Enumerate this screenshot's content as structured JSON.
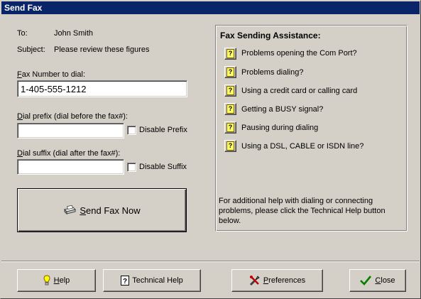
{
  "window": {
    "title": "Send Fax"
  },
  "message": {
    "to_label": "To:",
    "to_value": "John Smith",
    "subject_label": "Subject:",
    "subject_value": "Please review these figures"
  },
  "fax_number": {
    "label_accel": "F",
    "label_rest": "ax Number to dial:",
    "value": "1-405-555-1212"
  },
  "dial_prefix": {
    "label_accel": "D",
    "label_rest": "ial prefix (dial before the fax#):",
    "value": "",
    "checkbox_label": "Disable Prefix",
    "checked": false
  },
  "dial_suffix": {
    "label_accel": "D",
    "label_rest": "ial suffix (dial after the fax#):",
    "value": "",
    "checkbox_label": "Disable Suffix",
    "checked": false
  },
  "send_button": {
    "label_accel": "S",
    "label_rest": "end Fax Now",
    "icon": "fax-machine-icon"
  },
  "assistance": {
    "title": "Fax Sending Assistance:",
    "items": [
      {
        "label": "Problems opening the Com Port?",
        "icon": "help-question-icon"
      },
      {
        "label": "Problems dialing?",
        "icon": "help-question-icon"
      },
      {
        "label": "Using a credit card or calling card",
        "icon": "help-question-icon"
      },
      {
        "label": "Getting a BUSY signal?",
        "icon": "help-question-icon"
      },
      {
        "label": "Pausing during dialing",
        "icon": "help-question-icon"
      },
      {
        "label": "Using a DSL, CABLE or ISDN line?",
        "icon": "help-question-icon"
      }
    ],
    "footer_note": "For additional help with dialing or connecting problems, please click the Technical Help button below."
  },
  "footer": {
    "help": {
      "label_accel": "H",
      "label_rest": "elp",
      "icon": "lightbulb-icon"
    },
    "technical_help": {
      "label": "Technical Help",
      "icon": "question-book-icon"
    },
    "preferences": {
      "label_accel": "P",
      "label_rest": "references",
      "icon": "tools-icon"
    },
    "close": {
      "label_accel": "C",
      "label_rest": "lose",
      "icon": "checkmark-icon"
    }
  },
  "colors": {
    "titlebar": "#0a246a",
    "face": "#d4d0c8",
    "close_check": "#008000"
  }
}
